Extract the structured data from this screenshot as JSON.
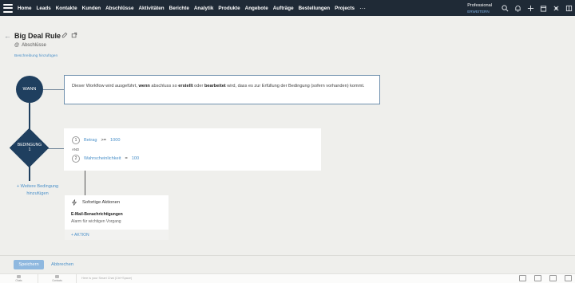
{
  "nav": {
    "items": [
      "Home",
      "Leads",
      "Kontakte",
      "Kunden",
      "Abschlüsse",
      "Aktivitäten",
      "Berichte",
      "Analytik",
      "Produkte",
      "Angebote",
      "Aufträge",
      "Bestellungen",
      "Projects"
    ],
    "more": "···",
    "edition": "Professional",
    "upgrade": "ERWEITERN"
  },
  "header": {
    "title": "Big Deal Rule",
    "entity_prefix": "@",
    "entity": "Abschlüsse",
    "add_description": "Beschreibung hinzufügen"
  },
  "when_node": {
    "label": "WANN"
  },
  "when_box": {
    "part1": "Dieser Workflow wird ausgeführt, ",
    "kw1": "wenn",
    "part2": " abschluss so ",
    "kw2": "erstellt",
    "part3": " oder ",
    "kw3": "bearbeitet",
    "part4": " wird, dass es zur Erfüllung der Bedingung (sofern vorhanden) kommt."
  },
  "condition_node": {
    "label_line1": "BEDINGUNG",
    "label_line2": "1"
  },
  "conditions": [
    {
      "num": "1",
      "field": "Betrag",
      "op": ">=",
      "value": "1000"
    },
    {
      "num": "2",
      "field": "Wahrscheinlichkeit",
      "op": "=",
      "value": "100"
    }
  ],
  "conditions_joiner": "AND",
  "more_condition": {
    "line1": "+ Weitere Bedingung",
    "line2": "hinzufügen"
  },
  "actions": {
    "header": "Sofortige Aktionen",
    "title": "E-Mail-Benachrichtigungen",
    "subtitle": "Alarm für wichtigen Vorgang",
    "add": "+ AKTION"
  },
  "footer": {
    "save": "Speichern",
    "cancel": "Abbrechen"
  },
  "bottombar": {
    "tabs": [
      "Chats",
      "Contacts"
    ],
    "input_placeholder": "Here is your Smart Chat (Ctrl+Space)"
  }
}
